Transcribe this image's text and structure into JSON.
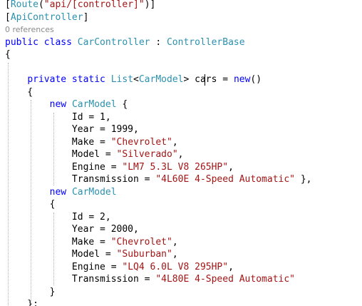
{
  "editor": {
    "language": "C#",
    "lines": [
      {
        "kind": "code",
        "tokens": [
          {
            "t": "plain",
            "v": "["
          },
          {
            "t": "type",
            "v": "Route"
          },
          {
            "t": "plain",
            "v": "("
          },
          {
            "t": "str",
            "v": "\"api/[controller]\""
          },
          {
            "t": "plain",
            "v": ")]"
          }
        ]
      },
      {
        "kind": "code",
        "tokens": [
          {
            "t": "plain",
            "v": "["
          },
          {
            "t": "type",
            "v": "ApiController"
          },
          {
            "t": "plain",
            "v": "]"
          }
        ]
      },
      {
        "kind": "codelens",
        "text": "0 references"
      },
      {
        "kind": "code",
        "tokens": [
          {
            "t": "kw",
            "v": "public class "
          },
          {
            "t": "type",
            "v": "CarController"
          },
          {
            "t": "plain",
            "v": " : "
          },
          {
            "t": "type",
            "v": "ControllerBase"
          }
        ]
      },
      {
        "kind": "code",
        "tokens": [
          {
            "t": "plain",
            "v": "{"
          }
        ]
      },
      {
        "kind": "code",
        "tokens": [
          {
            "t": "plain",
            "v": ""
          }
        ]
      },
      {
        "kind": "code",
        "tokens": [
          {
            "t": "plain",
            "v": "    "
          },
          {
            "t": "kw",
            "v": "private static "
          },
          {
            "t": "type",
            "v": "List"
          },
          {
            "t": "plain",
            "v": "<"
          },
          {
            "t": "type",
            "v": "CarModel"
          },
          {
            "t": "plain",
            "v": "> cars = "
          },
          {
            "t": "kw",
            "v": "new"
          },
          {
            "t": "plain",
            "v": "()"
          }
        ]
      },
      {
        "kind": "code",
        "tokens": [
          {
            "t": "plain",
            "v": "    {"
          }
        ]
      },
      {
        "kind": "code",
        "tokens": [
          {
            "t": "plain",
            "v": "        "
          },
          {
            "t": "kw",
            "v": "new "
          },
          {
            "t": "type",
            "v": "CarModel"
          },
          {
            "t": "plain",
            "v": " {"
          }
        ]
      },
      {
        "kind": "code",
        "tokens": [
          {
            "t": "plain",
            "v": "            Id = 1,"
          }
        ]
      },
      {
        "kind": "code",
        "tokens": [
          {
            "t": "plain",
            "v": "            Year = 1999,"
          }
        ]
      },
      {
        "kind": "code",
        "tokens": [
          {
            "t": "plain",
            "v": "            Make = "
          },
          {
            "t": "str",
            "v": "\"Chevrolet\""
          },
          {
            "t": "plain",
            "v": ","
          }
        ]
      },
      {
        "kind": "code",
        "tokens": [
          {
            "t": "plain",
            "v": "            Model = "
          },
          {
            "t": "str",
            "v": "\"Silverado\""
          },
          {
            "t": "plain",
            "v": ","
          }
        ]
      },
      {
        "kind": "code",
        "tokens": [
          {
            "t": "plain",
            "v": "            Engine = "
          },
          {
            "t": "str",
            "v": "\"LM7 5.3L V8 265HP\""
          },
          {
            "t": "plain",
            "v": ","
          }
        ]
      },
      {
        "kind": "code",
        "tokens": [
          {
            "t": "plain",
            "v": "            Transmission = "
          },
          {
            "t": "str",
            "v": "\"4L60E 4-Speed Automatic\""
          },
          {
            "t": "plain",
            "v": " },"
          }
        ]
      },
      {
        "kind": "code",
        "tokens": [
          {
            "t": "plain",
            "v": "        "
          },
          {
            "t": "kw",
            "v": "new "
          },
          {
            "t": "type",
            "v": "CarModel"
          }
        ]
      },
      {
        "kind": "code",
        "tokens": [
          {
            "t": "plain",
            "v": "        {"
          }
        ]
      },
      {
        "kind": "code",
        "tokens": [
          {
            "t": "plain",
            "v": "            Id = 2,"
          }
        ]
      },
      {
        "kind": "code",
        "tokens": [
          {
            "t": "plain",
            "v": "            Year = 2000,"
          }
        ]
      },
      {
        "kind": "code",
        "tokens": [
          {
            "t": "plain",
            "v": "            Make = "
          },
          {
            "t": "str",
            "v": "\"Chevrolet\""
          },
          {
            "t": "plain",
            "v": ","
          }
        ]
      },
      {
        "kind": "code",
        "tokens": [
          {
            "t": "plain",
            "v": "            Model = "
          },
          {
            "t": "str",
            "v": "\"Suburban\""
          },
          {
            "t": "plain",
            "v": ","
          }
        ]
      },
      {
        "kind": "code",
        "tokens": [
          {
            "t": "plain",
            "v": "            Engine = "
          },
          {
            "t": "str",
            "v": "\"LQ4 6.0L V8 295HP\""
          },
          {
            "t": "plain",
            "v": ","
          }
        ]
      },
      {
        "kind": "code",
        "tokens": [
          {
            "t": "plain",
            "v": "            Transmission = "
          },
          {
            "t": "str",
            "v": "\"4L80E 4-Speed Automatic\""
          }
        ]
      },
      {
        "kind": "code",
        "tokens": [
          {
            "t": "plain",
            "v": "        }"
          }
        ]
      },
      {
        "kind": "code",
        "tokens": [
          {
            "t": "plain",
            "v": "    };"
          }
        ]
      }
    ]
  },
  "colors": {
    "keyword": "#0000ff",
    "type": "#2b91af",
    "string": "#a31515",
    "plain": "#000000",
    "codelens": "#8a8a8a",
    "background": "#ffffff"
  }
}
